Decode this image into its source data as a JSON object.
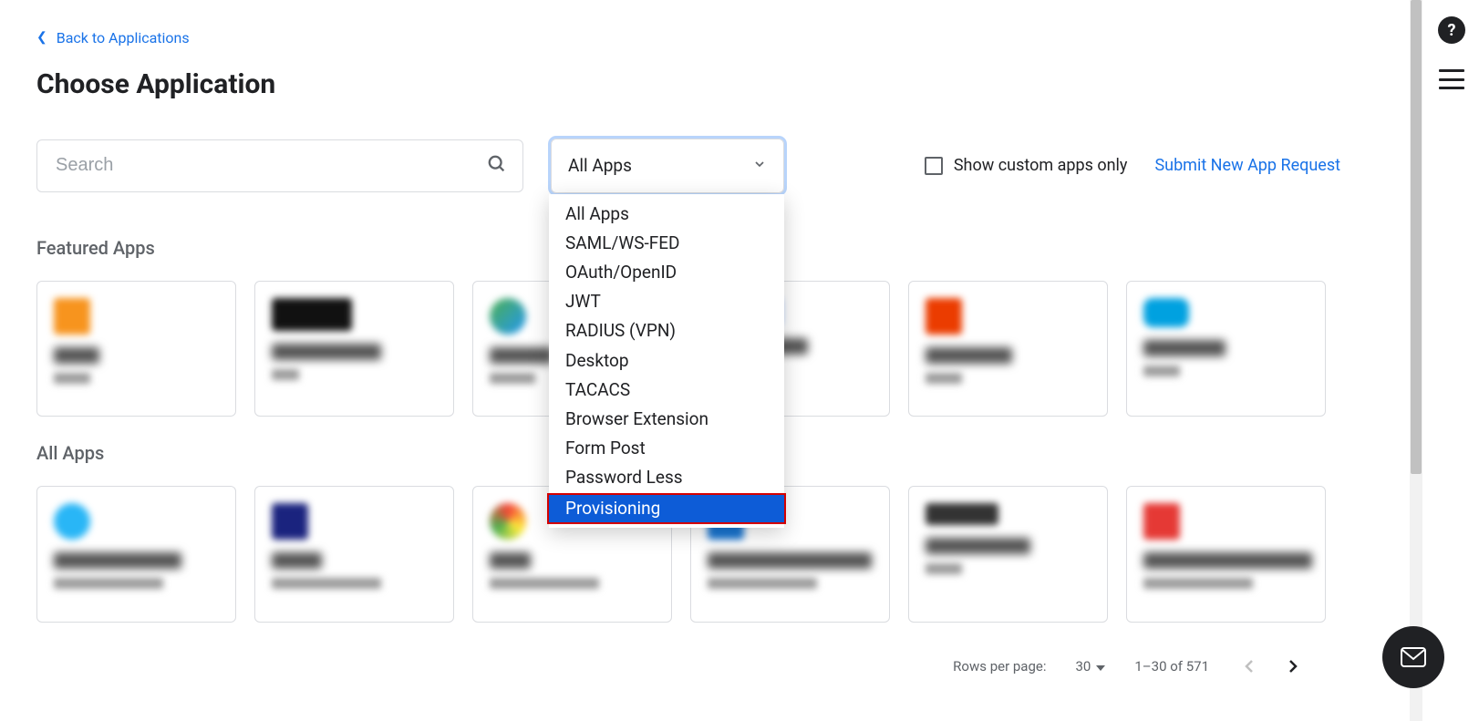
{
  "back_link": "Back to Applications",
  "page_title": "Choose Application",
  "search": {
    "placeholder": "Search"
  },
  "filter": {
    "selected": "All Apps",
    "options": [
      "All Apps",
      "SAML/WS-FED",
      "OAuth/OpenID",
      "JWT",
      "RADIUS (VPN)",
      "Desktop",
      "TACACS",
      "Browser Extension",
      "Form Post",
      "Password Less",
      "Provisioning"
    ],
    "highlighted": "Provisioning"
  },
  "checkbox_label": "Show custom apps only",
  "submit_link": "Submit New App Request",
  "sections": {
    "featured": "Featured Apps",
    "all": "All Apps"
  },
  "pagination": {
    "rows_label": "Rows per page:",
    "rows_value": "30",
    "range": "1–30 of 571"
  }
}
